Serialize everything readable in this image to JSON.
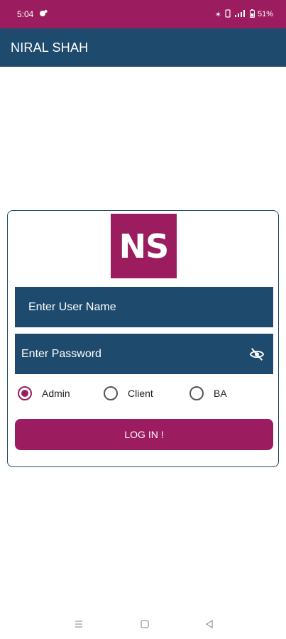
{
  "status_bar": {
    "time": "5:04",
    "battery": "51%",
    "background_color": "#9b1d5f",
    "icons": [
      "bluetooth-icon",
      "vibrate-icon",
      "signal-icon",
      "battery-icon"
    ]
  },
  "app_bar": {
    "title": "NIRAL SHAH",
    "background_color": "#1e4a6e"
  },
  "login_form": {
    "logo_text": "NS",
    "username_placeholder": "Enter User Name",
    "password_placeholder": "Enter Password",
    "roles": [
      {
        "label": "Admin",
        "selected": true
      },
      {
        "label": "Client",
        "selected": false
      },
      {
        "label": "BA",
        "selected": false
      }
    ],
    "login_label": "LOG IN !",
    "accent_color": "#9b1d5f"
  },
  "nav_bar": {
    "icons": [
      "menu-icon",
      "home-icon",
      "back-icon"
    ]
  }
}
